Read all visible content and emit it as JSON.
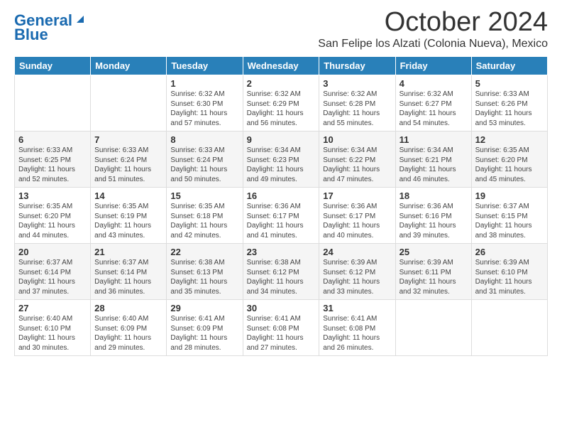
{
  "logo": {
    "line1": "General",
    "line2": "Blue"
  },
  "title": "October 2024",
  "subtitle": "San Felipe los Alzati (Colonia Nueva), Mexico",
  "days_of_week": [
    "Sunday",
    "Monday",
    "Tuesday",
    "Wednesday",
    "Thursday",
    "Friday",
    "Saturday"
  ],
  "weeks": [
    [
      {
        "day": "",
        "info": ""
      },
      {
        "day": "",
        "info": ""
      },
      {
        "day": "1",
        "info": "Sunrise: 6:32 AM\nSunset: 6:30 PM\nDaylight: 11 hours and 57 minutes."
      },
      {
        "day": "2",
        "info": "Sunrise: 6:32 AM\nSunset: 6:29 PM\nDaylight: 11 hours and 56 minutes."
      },
      {
        "day": "3",
        "info": "Sunrise: 6:32 AM\nSunset: 6:28 PM\nDaylight: 11 hours and 55 minutes."
      },
      {
        "day": "4",
        "info": "Sunrise: 6:32 AM\nSunset: 6:27 PM\nDaylight: 11 hours and 54 minutes."
      },
      {
        "day": "5",
        "info": "Sunrise: 6:33 AM\nSunset: 6:26 PM\nDaylight: 11 hours and 53 minutes."
      }
    ],
    [
      {
        "day": "6",
        "info": "Sunrise: 6:33 AM\nSunset: 6:25 PM\nDaylight: 11 hours and 52 minutes."
      },
      {
        "day": "7",
        "info": "Sunrise: 6:33 AM\nSunset: 6:24 PM\nDaylight: 11 hours and 51 minutes."
      },
      {
        "day": "8",
        "info": "Sunrise: 6:33 AM\nSunset: 6:24 PM\nDaylight: 11 hours and 50 minutes."
      },
      {
        "day": "9",
        "info": "Sunrise: 6:34 AM\nSunset: 6:23 PM\nDaylight: 11 hours and 49 minutes."
      },
      {
        "day": "10",
        "info": "Sunrise: 6:34 AM\nSunset: 6:22 PM\nDaylight: 11 hours and 47 minutes."
      },
      {
        "day": "11",
        "info": "Sunrise: 6:34 AM\nSunset: 6:21 PM\nDaylight: 11 hours and 46 minutes."
      },
      {
        "day": "12",
        "info": "Sunrise: 6:35 AM\nSunset: 6:20 PM\nDaylight: 11 hours and 45 minutes."
      }
    ],
    [
      {
        "day": "13",
        "info": "Sunrise: 6:35 AM\nSunset: 6:20 PM\nDaylight: 11 hours and 44 minutes."
      },
      {
        "day": "14",
        "info": "Sunrise: 6:35 AM\nSunset: 6:19 PM\nDaylight: 11 hours and 43 minutes."
      },
      {
        "day": "15",
        "info": "Sunrise: 6:35 AM\nSunset: 6:18 PM\nDaylight: 11 hours and 42 minutes."
      },
      {
        "day": "16",
        "info": "Sunrise: 6:36 AM\nSunset: 6:17 PM\nDaylight: 11 hours and 41 minutes."
      },
      {
        "day": "17",
        "info": "Sunrise: 6:36 AM\nSunset: 6:17 PM\nDaylight: 11 hours and 40 minutes."
      },
      {
        "day": "18",
        "info": "Sunrise: 6:36 AM\nSunset: 6:16 PM\nDaylight: 11 hours and 39 minutes."
      },
      {
        "day": "19",
        "info": "Sunrise: 6:37 AM\nSunset: 6:15 PM\nDaylight: 11 hours and 38 minutes."
      }
    ],
    [
      {
        "day": "20",
        "info": "Sunrise: 6:37 AM\nSunset: 6:14 PM\nDaylight: 11 hours and 37 minutes."
      },
      {
        "day": "21",
        "info": "Sunrise: 6:37 AM\nSunset: 6:14 PM\nDaylight: 11 hours and 36 minutes."
      },
      {
        "day": "22",
        "info": "Sunrise: 6:38 AM\nSunset: 6:13 PM\nDaylight: 11 hours and 35 minutes."
      },
      {
        "day": "23",
        "info": "Sunrise: 6:38 AM\nSunset: 6:12 PM\nDaylight: 11 hours and 34 minutes."
      },
      {
        "day": "24",
        "info": "Sunrise: 6:39 AM\nSunset: 6:12 PM\nDaylight: 11 hours and 33 minutes."
      },
      {
        "day": "25",
        "info": "Sunrise: 6:39 AM\nSunset: 6:11 PM\nDaylight: 11 hours and 32 minutes."
      },
      {
        "day": "26",
        "info": "Sunrise: 6:39 AM\nSunset: 6:10 PM\nDaylight: 11 hours and 31 minutes."
      }
    ],
    [
      {
        "day": "27",
        "info": "Sunrise: 6:40 AM\nSunset: 6:10 PM\nDaylight: 11 hours and 30 minutes."
      },
      {
        "day": "28",
        "info": "Sunrise: 6:40 AM\nSunset: 6:09 PM\nDaylight: 11 hours and 29 minutes."
      },
      {
        "day": "29",
        "info": "Sunrise: 6:41 AM\nSunset: 6:09 PM\nDaylight: 11 hours and 28 minutes."
      },
      {
        "day": "30",
        "info": "Sunrise: 6:41 AM\nSunset: 6:08 PM\nDaylight: 11 hours and 27 minutes."
      },
      {
        "day": "31",
        "info": "Sunrise: 6:41 AM\nSunset: 6:08 PM\nDaylight: 11 hours and 26 minutes."
      },
      {
        "day": "",
        "info": ""
      },
      {
        "day": "",
        "info": ""
      }
    ]
  ]
}
